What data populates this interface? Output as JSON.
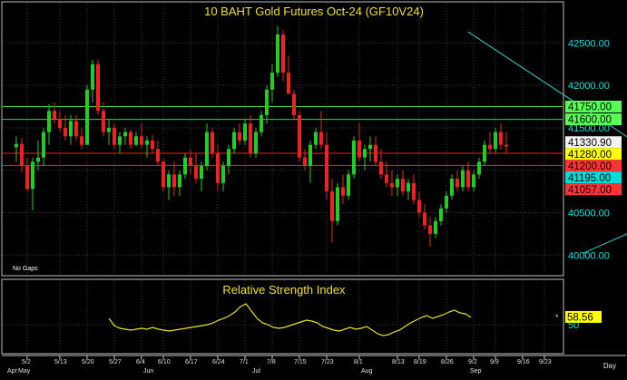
{
  "chart_data": [
    {
      "type": "candlestick",
      "title": "10 BAHT Gold Futures Oct-24 (GF10V24)",
      "note": "No Gaps",
      "y_ticks": [
        40000,
        40500,
        41000,
        41500,
        42000,
        42500
      ],
      "y_tick_labels": [
        "40000.00",
        "40500.00",
        "41000.00",
        "41500.00",
        "42000.00",
        "42500.00"
      ],
      "ylim": [
        39800,
        42750
      ],
      "grid": true,
      "levels": [
        {
          "label": "41750.00",
          "value": 41750,
          "bg": "#55ff55",
          "line": "#33dd33"
        },
        {
          "label": "41600.00",
          "value": 41600,
          "bg": "#55ff55",
          "line": "#33dd33"
        },
        {
          "label": "41330.90",
          "value": 41330.9,
          "bg": "#f2f2f2",
          "line": null
        },
        {
          "label": "41280.00",
          "value": 41280,
          "bg": "#ffff00",
          "line": null
        },
        {
          "label": "41200.00",
          "value": 41200,
          "bg": "#ff3333",
          "line": "#ee2222"
        },
        {
          "label": "41195.00",
          "value": 41195,
          "bg": "#00dddd",
          "line": null
        },
        {
          "label": "41057.00",
          "value": 41057,
          "bg": "#ff3333",
          "line": "#ee2222"
        }
      ],
      "trendlines": [
        {
          "x1": 83,
          "y1": 42630,
          "x2": 148,
          "y2": 39880
        },
        {
          "x1": 104,
          "y1": 40020,
          "x2": 147,
          "y2": 41230
        },
        {
          "x1": 139,
          "y1": 40050,
          "x2": 151,
          "y2": 41360
        }
      ],
      "up_color": "#22cc22",
      "down_color": "#ee2222",
      "candles": [
        [
          41270,
          41400,
          41100,
          41310
        ],
        [
          41310,
          41380,
          40980,
          41050
        ],
        [
          41050,
          41150,
          40750,
          40780
        ],
        [
          40780,
          41150,
          40530,
          41100
        ],
        [
          41100,
          41350,
          41000,
          41150
        ],
        [
          41150,
          41500,
          41050,
          41450
        ],
        [
          41450,
          41780,
          41300,
          41700
        ],
        [
          41700,
          41800,
          41550,
          41600
        ],
        [
          41600,
          41700,
          41450,
          41500
        ],
        [
          41500,
          41650,
          41350,
          41400
        ],
        [
          41400,
          41650,
          41300,
          41580
        ],
        [
          41580,
          41650,
          41350,
          41400
        ],
        [
          41400,
          41500,
          41250,
          41300
        ],
        [
          41300,
          42000,
          41300,
          41950
        ],
        [
          41950,
          42300,
          41800,
          42250
        ],
        [
          42250,
          42300,
          41650,
          41700
        ],
        [
          41700,
          41800,
          41400,
          41450
        ],
        [
          41450,
          41600,
          41300,
          41500
        ],
        [
          41500,
          41550,
          41250,
          41300
        ],
        [
          41300,
          41450,
          41200,
          41400
        ],
        [
          41400,
          41500,
          41300,
          41450
        ],
        [
          41450,
          41480,
          41250,
          41300
        ],
        [
          41300,
          41450,
          41280,
          41400
        ],
        [
          41400,
          41550,
          41250,
          41300
        ],
        [
          41300,
          41400,
          41150,
          41350
        ],
        [
          41350,
          41420,
          41200,
          41250
        ],
        [
          41250,
          41350,
          41050,
          41100
        ],
        [
          41100,
          41130,
          40750,
          40800
        ],
        [
          40800,
          41000,
          40650,
          40950
        ],
        [
          40950,
          41100,
          40700,
          40800
        ],
        [
          40800,
          41000,
          40700,
          40950
        ],
        [
          40950,
          41200,
          40900,
          41150
        ],
        [
          41150,
          41250,
          40950,
          41050
        ],
        [
          41050,
          41200,
          40850,
          40900
        ],
        [
          40900,
          41100,
          40750,
          41050
        ],
        [
          41050,
          41550,
          41000,
          41450
        ],
        [
          41450,
          41500,
          41150,
          41200
        ],
        [
          41200,
          41300,
          40750,
          40850
        ],
        [
          40850,
          41100,
          40750,
          41050
        ],
        [
          41050,
          41300,
          40950,
          41250
        ],
        [
          41250,
          41500,
          41200,
          41450
        ],
        [
          41450,
          41550,
          41300,
          41350
        ],
        [
          41350,
          41600,
          41300,
          41550
        ],
        [
          41550,
          41650,
          41150,
          41200
        ],
        [
          41200,
          41500,
          41150,
          41450
        ],
        [
          41450,
          41700,
          41400,
          41650
        ],
        [
          41650,
          42000,
          41550,
          41950
        ],
        [
          41950,
          42250,
          41800,
          42150
        ],
        [
          42150,
          42700,
          42100,
          42600
        ],
        [
          42600,
          42650,
          42050,
          42150
        ],
        [
          42150,
          42350,
          41900,
          41900
        ],
        [
          41900,
          41950,
          41600,
          41650
        ],
        [
          41650,
          41700,
          41100,
          41150
        ],
        [
          41150,
          41250,
          41000,
          41050
        ],
        [
          41050,
          41350,
          40850,
          41300
        ],
        [
          41300,
          41500,
          41250,
          41450
        ],
        [
          41450,
          41700,
          41250,
          41300
        ],
        [
          41300,
          41450,
          40650,
          40750
        ],
        [
          40750,
          40900,
          40150,
          40400
        ],
        [
          40400,
          40850,
          40350,
          40800
        ],
        [
          40800,
          40950,
          40600,
          40700
        ],
        [
          40700,
          41000,
          40650,
          40950
        ],
        [
          40950,
          41400,
          40900,
          41350
        ],
        [
          41350,
          41550,
          41100,
          41150
        ],
        [
          41150,
          41300,
          41000,
          41250
        ],
        [
          41250,
          41400,
          41100,
          41300
        ],
        [
          41300,
          41400,
          41050,
          41100
        ],
        [
          41100,
          41250,
          40900,
          40950
        ],
        [
          40950,
          41100,
          40800,
          40850
        ],
        [
          40850,
          41000,
          40700,
          40800
        ],
        [
          40800,
          40950,
          40700,
          40900
        ],
        [
          40900,
          41000,
          40700,
          40750
        ],
        [
          40750,
          40900,
          40650,
          40850
        ],
        [
          40850,
          40950,
          40600,
          40650
        ],
        [
          40650,
          40750,
          40450,
          40500
        ],
        [
          40500,
          40600,
          40300,
          40350
        ],
        [
          40350,
          40450,
          40100,
          40250
        ],
        [
          40250,
          40450,
          40200,
          40400
        ],
        [
          40400,
          40600,
          40350,
          40550
        ],
        [
          40550,
          40750,
          40500,
          40700
        ],
        [
          40700,
          40950,
          40650,
          40900
        ],
        [
          40900,
          41000,
          40750,
          40800
        ],
        [
          40800,
          41050,
          40750,
          41000
        ],
        [
          41000,
          41100,
          40750,
          40800
        ],
        [
          40800,
          41000,
          40750,
          40950
        ],
        [
          40950,
          41150,
          40900,
          41100
        ],
        [
          41100,
          41350,
          41050,
          41300
        ],
        [
          41300,
          41450,
          41200,
          41250
        ],
        [
          41250,
          41500,
          41200,
          41450
        ],
        [
          41450,
          41550,
          41250,
          41300
        ],
        [
          41300,
          41450,
          41200,
          41280
        ]
      ],
      "x_labels": [
        {
          "text": "5/2",
          "i": 2
        },
        {
          "text": "5/13",
          "i": 8
        },
        {
          "text": "5/20",
          "i": 13
        },
        {
          "text": "5/27",
          "i": 18
        },
        {
          "text": "6/4",
          "i": 23
        },
        {
          "text": "6/10",
          "i": 27
        },
        {
          "text": "6/17",
          "i": 32
        },
        {
          "text": "6/24",
          "i": 37
        },
        {
          "text": "7/1",
          "i": 42
        },
        {
          "text": "7/8",
          "i": 47
        },
        {
          "text": "7/15",
          "i": 52
        },
        {
          "text": "7/23",
          "i": 57
        },
        {
          "text": "8/1",
          "i": 63
        },
        {
          "text": "8/13",
          "i": 70
        },
        {
          "text": "8/19",
          "i": 74
        },
        {
          "text": "8/26",
          "i": 79
        },
        {
          "text": "9/2",
          "i": 84
        },
        {
          "text": "9/9",
          "i": 88
        },
        {
          "text": "9/16",
          "i": 93
        },
        {
          "text": "9/23",
          "i": 97
        }
      ],
      "month_labels": [
        {
          "text": "Apr",
          "i": -1
        },
        {
          "text": "May",
          "i": 1
        },
        {
          "text": "Jun",
          "i": 24
        },
        {
          "text": "Jul",
          "i": 44
        },
        {
          "text": "Aug",
          "i": 64
        },
        {
          "text": "Sep",
          "i": 84
        }
      ],
      "xlabel": "Day"
    },
    {
      "type": "line",
      "title": "Relative Strength Index",
      "y_ticks": [
        50
      ],
      "y_tick_labels": [
        "50"
      ],
      "ylim": [
        20,
        80
      ],
      "last_label": "58.56",
      "line_color": "#e8e020",
      "series": [
        {
          "start_index": 17,
          "values": [
            57,
            49,
            46,
            45,
            44,
            45,
            46,
            45,
            47,
            45,
            44,
            43,
            44,
            45,
            46,
            47,
            48,
            49,
            50,
            52,
            55,
            57,
            60,
            64,
            70,
            73,
            65,
            57,
            52,
            50,
            47,
            46,
            47,
            49,
            51,
            53,
            55,
            54,
            52,
            48,
            46,
            44,
            43,
            45,
            47,
            45,
            46,
            48,
            44,
            40,
            38,
            39,
            42,
            44,
            48,
            52,
            55,
            58,
            60,
            57,
            59,
            61,
            64,
            66,
            63,
            62,
            58
          ]
        }
      ]
    }
  ]
}
